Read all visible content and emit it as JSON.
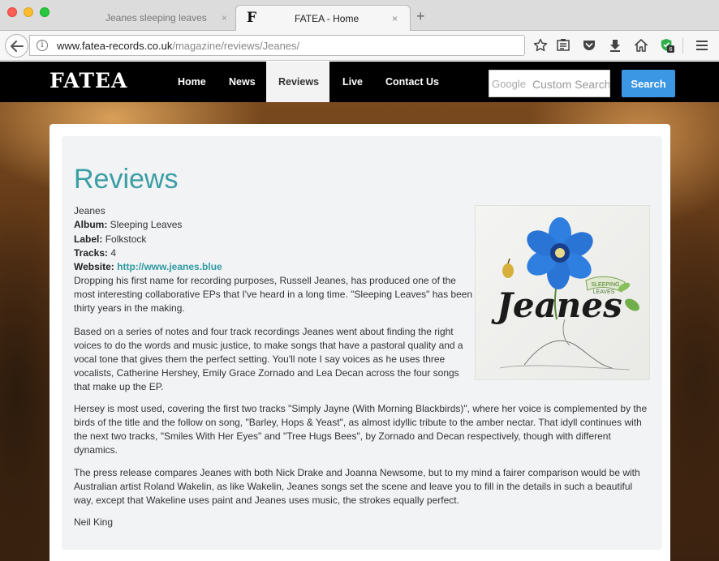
{
  "browser": {
    "tabs": [
      {
        "title": "Jeanes sleeping leaves",
        "active": false
      },
      {
        "title": "FATEA - Home",
        "active": true,
        "favicon": "F"
      }
    ],
    "close_glyph": "×",
    "newtab_glyph": "+",
    "url_host": "www.fatea-records.co.uk",
    "url_path": "/magazine/reviews/Jeanes/",
    "info_glyph": "i",
    "addon_badge": "6",
    "icons": [
      "back-arrow-icon",
      "info-icon",
      "star-icon",
      "reader-list-icon",
      "pocket-icon",
      "download-icon",
      "home-icon",
      "shield-addon-icon",
      "hamburger-menu-icon"
    ]
  },
  "site": {
    "logo": "FATEA",
    "nav": [
      {
        "label": "Home"
      },
      {
        "label": "News"
      },
      {
        "label": "Reviews",
        "active": true
      },
      {
        "label": "Live"
      },
      {
        "label": "Contact Us"
      }
    ],
    "search": {
      "brand": "Google",
      "placeholder": "Custom Search",
      "button": "Search"
    }
  },
  "review": {
    "heading": "Reviews",
    "artist": "Jeanes",
    "album_label": "Album:",
    "album": "Sleeping Leaves",
    "label_label": "Label:",
    "label": "Folkstock",
    "tracks_label": "Tracks:",
    "tracks": "4",
    "website_label": "Website:",
    "website": "http://www.jeanes.blue",
    "paragraphs": [
      "Dropping his first name for recording purposes, Russell Jeanes, has produced one of the most interesting collaborative EPs that I've heard in a long time. \"Sleeping Leaves\" has been thirty years in the making.",
      "Based on a series of notes and four track recordings Jeanes went about finding the right voices to do the words and music justice, to make songs that have a pastoral quality and a vocal tone that gives them the perfect setting. You'll note I say voices as he uses three vocalists, Catherine Hershey, Emily Grace Zornado and Lea Decan across the four songs that make up the EP.",
      "Hersey is most used, covering the first two tracks \"Simply Jayne (With Morning Blackbirds)\", where her voice is complemented by the birds of the title and the follow on song, \"Barley, Hops & Yeast\", as almost idyllic tribute to the amber nectar. That idyll continues with the next two tracks, \"Smiles With Her Eyes\" and \"Tree Hugs Bees\", by Zornado and Decan respectively, though with different dynamics.",
      "The press release compares Jeanes with both Nick Drake and Joanna Newsome, but to my mind a fairer comparison would be with Australian artist Roland Wakelin, as like Wakelin, Jeanes songs set the scene and leave you to fill in the details in such a beautiful way, except that Wakeline uses paint and Jeanes uses music, the strokes equally perfect."
    ],
    "author": "Neil King",
    "cover": {
      "title": "Jeanes",
      "subtitle_1": "SLEEPING",
      "subtitle_2": "LEAVES"
    }
  },
  "colors": {
    "accent": "#3a9ea5",
    "link": "#2f9aa3",
    "search_button": "#3b96e4",
    "header_bg": "#000000"
  }
}
